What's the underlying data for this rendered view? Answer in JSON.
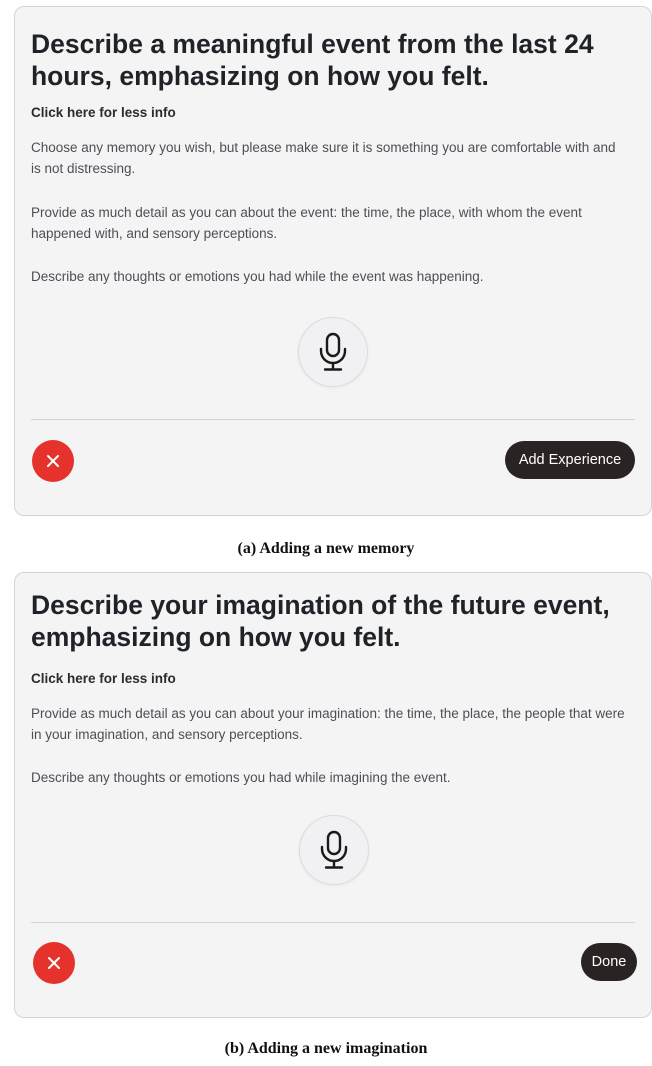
{
  "panel_a": {
    "title": "Describe a meaningful event from the last 24 hours, emphasizing on how you felt.",
    "info_toggle": "Click here for less info",
    "paragraphs": [
      "Choose any memory you wish, but please make sure it is something you are comfortable with and is not distressing.",
      "Provide as much detail as you can about the event: the time, the place, with whom the event happened with, and sensory perceptions.",
      "Describe any thoughts or emotions you had while the event was happening."
    ],
    "mic_icon": "microphone-icon",
    "cancel_icon": "close-icon",
    "action_label": "Add Experience"
  },
  "caption_a": "(a) Adding a new memory",
  "panel_b": {
    "title": "Describe your imagination of the future event, emphasizing on how you felt.",
    "info_toggle": "Click here for less info",
    "paragraphs": [
      "Provide as much detail as you can about your imagination: the time, the place, the people that were in your imagination, and sensory perceptions.",
      "Describe any thoughts or emotions you had while imagining the event."
    ],
    "mic_icon": "microphone-icon",
    "cancel_icon": "close-icon",
    "action_label": "Done"
  },
  "caption_b": "(b) Adding a new imagination",
  "colors": {
    "panel_bg": "#f4f4f5",
    "cancel_red": "#e5322c",
    "action_dark": "#2a2323",
    "text_primary": "#1f2328",
    "text_secondary": "#4b4f55"
  }
}
